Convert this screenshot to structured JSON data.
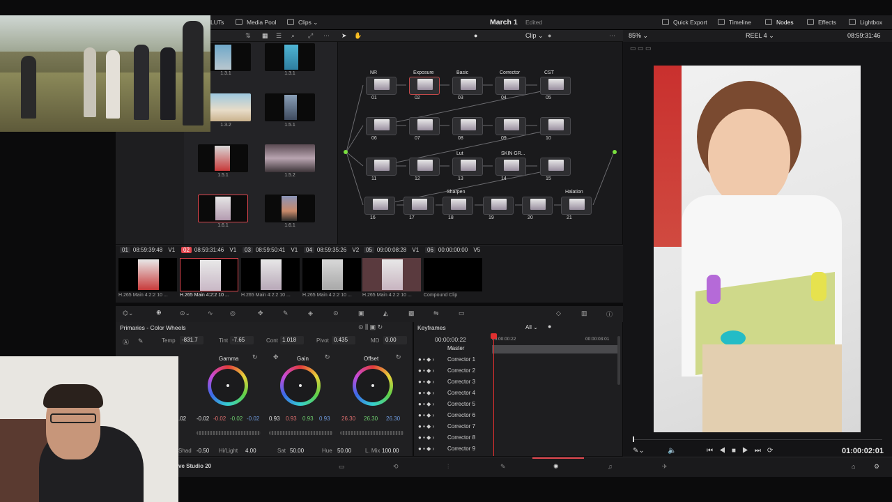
{
  "topbar": {
    "tabs": [
      "LUTs",
      "Media Pool",
      "Clips"
    ],
    "title": "March 1",
    "status": "Edited",
    "right_tabs": [
      "Quick Export",
      "Timeline",
      "Nodes",
      "Effects",
      "Lightbox"
    ]
  },
  "node_toolbar": {
    "mode": "Clip"
  },
  "viewer": {
    "zoom": "85%",
    "reel": "REEL 4",
    "timecode": "08:59:31:46",
    "transport_timecode": "01:00:02:01"
  },
  "media_pool": {
    "thumbs": [
      {
        "label": "1.3.1"
      },
      {
        "label": "1.3.1"
      },
      {
        "label": "1.3.2"
      },
      {
        "label": "1.5.1"
      },
      {
        "label": "1.5.1"
      },
      {
        "label": "1.5.2"
      },
      {
        "label": "1.6.1"
      },
      {
        "label": "1.6.1"
      }
    ]
  },
  "nodes": {
    "labels": [
      "NR",
      "Exposure",
      "Basic",
      "Corrector",
      "CST",
      "Lut",
      "SKIN GR...",
      "Sharpen",
      "Halation"
    ],
    "numbers": [
      "01",
      "02",
      "03",
      "04",
      "05",
      "06",
      "07",
      "08",
      "09",
      "10",
      "11",
      "12",
      "13",
      "14",
      "15",
      "16",
      "17",
      "18",
      "19",
      "20",
      "21"
    ]
  },
  "timeline_clips": [
    {
      "num": "01",
      "tc": "08:59:39:48",
      "track": "V1",
      "codec": "H.265 Main 4:2:2 10 ..."
    },
    {
      "num": "02",
      "tc": "08:59:31:46",
      "track": "V1",
      "codec": "H.265 Main 4:2:2 10 ..."
    },
    {
      "num": "03",
      "tc": "08:59:50:41",
      "track": "V1",
      "codec": "H.265 Main 4:2:2 10 ..."
    },
    {
      "num": "04",
      "tc": "08:59:35:26",
      "track": "V2",
      "codec": "H.265 Main 4:2:2 10 ..."
    },
    {
      "num": "05",
      "tc": "09:00:08:28",
      "track": "V1",
      "codec": "H.265 Main 4:2:2 10 ..."
    },
    {
      "num": "06",
      "tc": "00:00:00:00",
      "track": "V5",
      "codec": "Compound Clip"
    }
  ],
  "primaries": {
    "title": "Primaries - Color Wheels",
    "temp_label": "Temp",
    "temp": "-831.7",
    "tint_label": "Tint",
    "tint": "-7.65",
    "cont_label": "Cont",
    "cont": "1.018",
    "pivot_label": "Pivot",
    "pivot": "0.435",
    "md_label": "MD",
    "md": "0.00",
    "wheels": [
      {
        "name": "Gamma",
        "values": [
          "-0.02",
          "-0.02",
          "-0.02",
          "-0.02"
        ]
      },
      {
        "name": "Gain",
        "values": [
          "0.93",
          "0.93",
          "0.93",
          "0.93"
        ]
      },
      {
        "name": "Offset",
        "values": [
          "26.30",
          "26.30",
          "26.30"
        ]
      }
    ],
    "lift_partial": ".02",
    "shad_label": "Shad",
    "shad": "-0.50",
    "hilight_label": "Hi/Light",
    "hilight": "4.00",
    "sat_label": "Sat",
    "sat": "50.00",
    "hue_label": "Hue",
    "hue": "50.00",
    "lmix_label": "L. Mix",
    "lmix": "100.00"
  },
  "keyframes": {
    "title": "Keyframes",
    "filter": "All",
    "timecode": "00:00:00:22",
    "ruler_1": "00:00:00:22",
    "ruler_2": "00:00:03:01",
    "master": "Master",
    "rows": [
      "Corrector 1",
      "Corrector 2",
      "Corrector 3",
      "Corrector 4",
      "Corrector 5",
      "Corrector 6",
      "Corrector 7",
      "Corrector 8",
      "Corrector 9"
    ]
  },
  "app_name_partial": "ve Studio 20",
  "colors": {
    "accent_red": "#e0464e",
    "node_green": "#7ae03f",
    "playhead": "#e03030"
  }
}
